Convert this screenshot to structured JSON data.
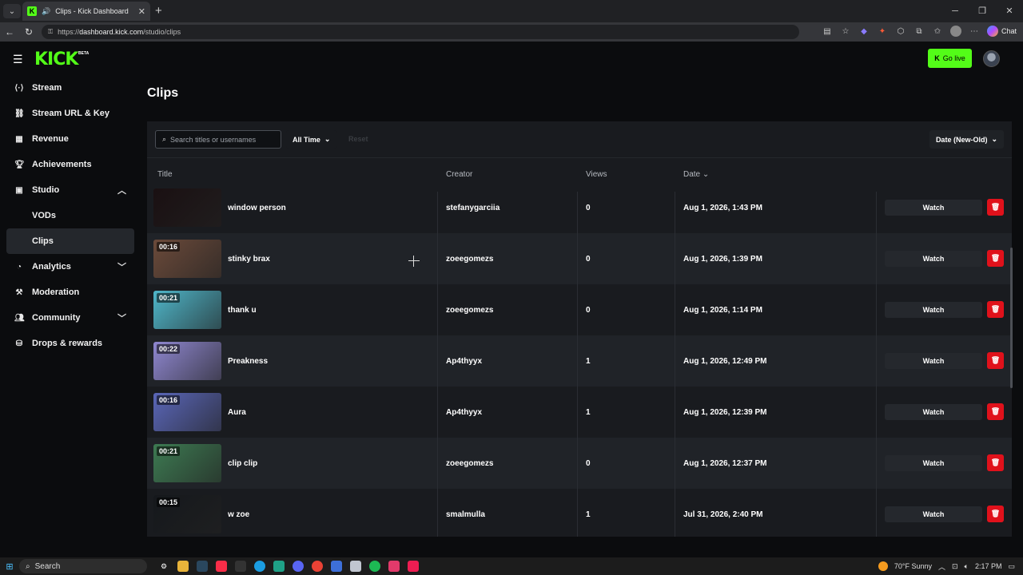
{
  "browser": {
    "tab_title": "Clips - Kick Dashboard",
    "url_prefix": "https://",
    "url_host": "dashboard.kick.com",
    "url_path": "/studio/clips",
    "chat_label": "Chat"
  },
  "header": {
    "logo": "KICK",
    "beta": "BETA",
    "go_live": "Go live"
  },
  "sidebar": {
    "items": [
      {
        "label": "Stream",
        "icon": "broadcast-icon"
      },
      {
        "label": "Stream URL & Key",
        "icon": "link-icon"
      },
      {
        "label": "Revenue",
        "icon": "chart-icon"
      },
      {
        "label": "Achievements",
        "icon": "trophy-icon"
      },
      {
        "label": "Studio",
        "icon": "film-icon"
      },
      {
        "label": "VODs"
      },
      {
        "label": "Clips"
      },
      {
        "label": "Analytics",
        "icon": "analytics-icon"
      },
      {
        "label": "Moderation",
        "icon": "hammer-icon"
      },
      {
        "label": "Community",
        "icon": "users-icon"
      },
      {
        "label": "Drops & rewards",
        "icon": "gift-icon"
      }
    ]
  },
  "page": {
    "title": "Clips"
  },
  "toolbar": {
    "search_placeholder": "Search titles or usernames",
    "time_filter": "All Time",
    "reset": "Reset",
    "sort": "Date (New-Old)"
  },
  "table": {
    "columns": {
      "title": "Title",
      "creator": "Creator",
      "views": "Views",
      "date": "Date"
    },
    "watch_label": "Watch",
    "rows": [
      {
        "duration": "",
        "title": "window person",
        "creator": "stefanygarciia",
        "views": "0",
        "date": "Aug 1, 2026, 1:43 PM",
        "thumb_color": "#1a1012"
      },
      {
        "duration": "00:16",
        "title": "stinky brax",
        "creator": "zoeegomezs",
        "views": "0",
        "date": "Aug 1, 2026, 1:39 PM",
        "thumb_color": "#6b4a3a"
      },
      {
        "duration": "00:21",
        "title": "thank u",
        "creator": "zoeegomezs",
        "views": "0",
        "date": "Aug 1, 2026, 1:14 PM",
        "thumb_color": "#4fb6c9"
      },
      {
        "duration": "00:22",
        "title": "Preakness",
        "creator": "Ap4thyyx",
        "views": "1",
        "date": "Aug 1, 2026, 12:49 PM",
        "thumb_color": "#8f87d0"
      },
      {
        "duration": "00:16",
        "title": "Aura",
        "creator": "Ap4thyyx",
        "views": "1",
        "date": "Aug 1, 2026, 12:39 PM",
        "thumb_color": "#5a66b8"
      },
      {
        "duration": "00:21",
        "title": "clip clip",
        "creator": "zoeegomezs",
        "views": "0",
        "date": "Aug 1, 2026, 12:37 PM",
        "thumb_color": "#3d7a52"
      },
      {
        "duration": "00:15",
        "title": "w zoe",
        "creator": "smalmulla",
        "views": "1",
        "date": "Jul 31, 2026, 2:40 PM",
        "thumb_color": "#15181c"
      }
    ]
  },
  "taskbar": {
    "search": "Search",
    "weather": "70°F  Sunny",
    "time": "2:17 PM"
  }
}
